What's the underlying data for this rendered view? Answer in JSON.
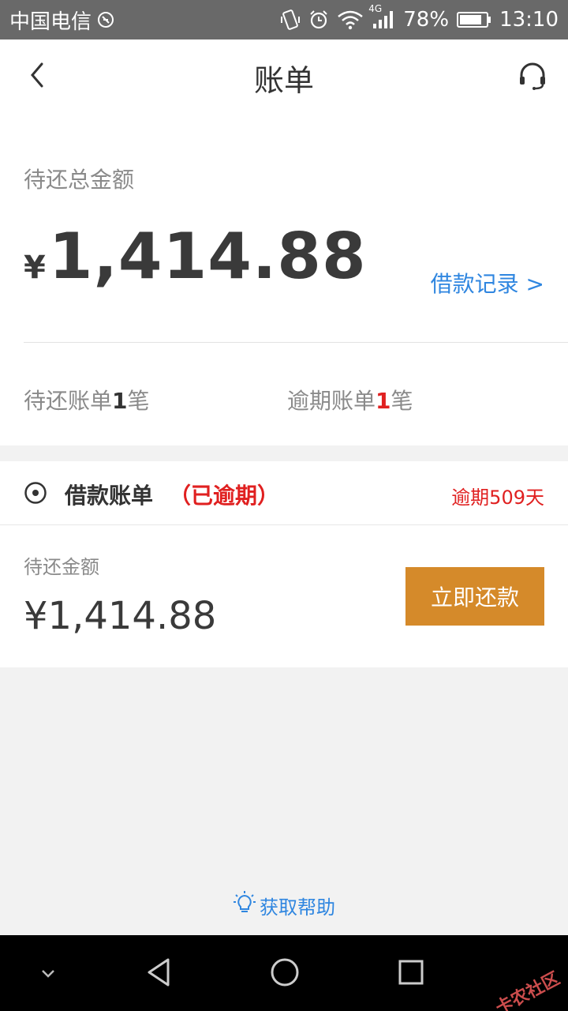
{
  "status_bar": {
    "carrier": "中国电信",
    "network": "4G",
    "battery": "78%",
    "time": "13:10",
    "icons": [
      "no-disturb-icon",
      "vibrate-icon",
      "alarm-icon",
      "wifi-icon",
      "signal-icon",
      "battery-icon"
    ]
  },
  "header": {
    "title": "账单",
    "back_icon": "chevron-left-icon",
    "service_icon": "headset-icon"
  },
  "summary": {
    "label": "待还总金额",
    "currency": "¥",
    "amount": "1,414.88",
    "loan_record_link": "借款记录 >",
    "pending_prefix": "待还账单",
    "pending_count": "1",
    "pending_suffix": "笔",
    "overdue_prefix": "逾期账单",
    "overdue_count": "1",
    "overdue_suffix": "笔"
  },
  "bill": {
    "title": "借款账单",
    "status": "（已逾期）",
    "overdue_days": "逾期509天",
    "due_label": "待还金额",
    "due_amount": "¥1,414.88",
    "repay_button": "立即还款"
  },
  "help": {
    "label": "获取帮助",
    "icon": "lightbulb-icon"
  },
  "nav": {
    "icons": [
      "chevron-down-icon",
      "back-triangle-icon",
      "home-circle-icon",
      "recents-square-icon"
    ]
  },
  "watermark": "卡农社区",
  "colors": {
    "accent_blue": "#2f86e0",
    "alert_red": "#e02020",
    "repay_button": "#d58a2a",
    "status_bar": "#696969"
  }
}
